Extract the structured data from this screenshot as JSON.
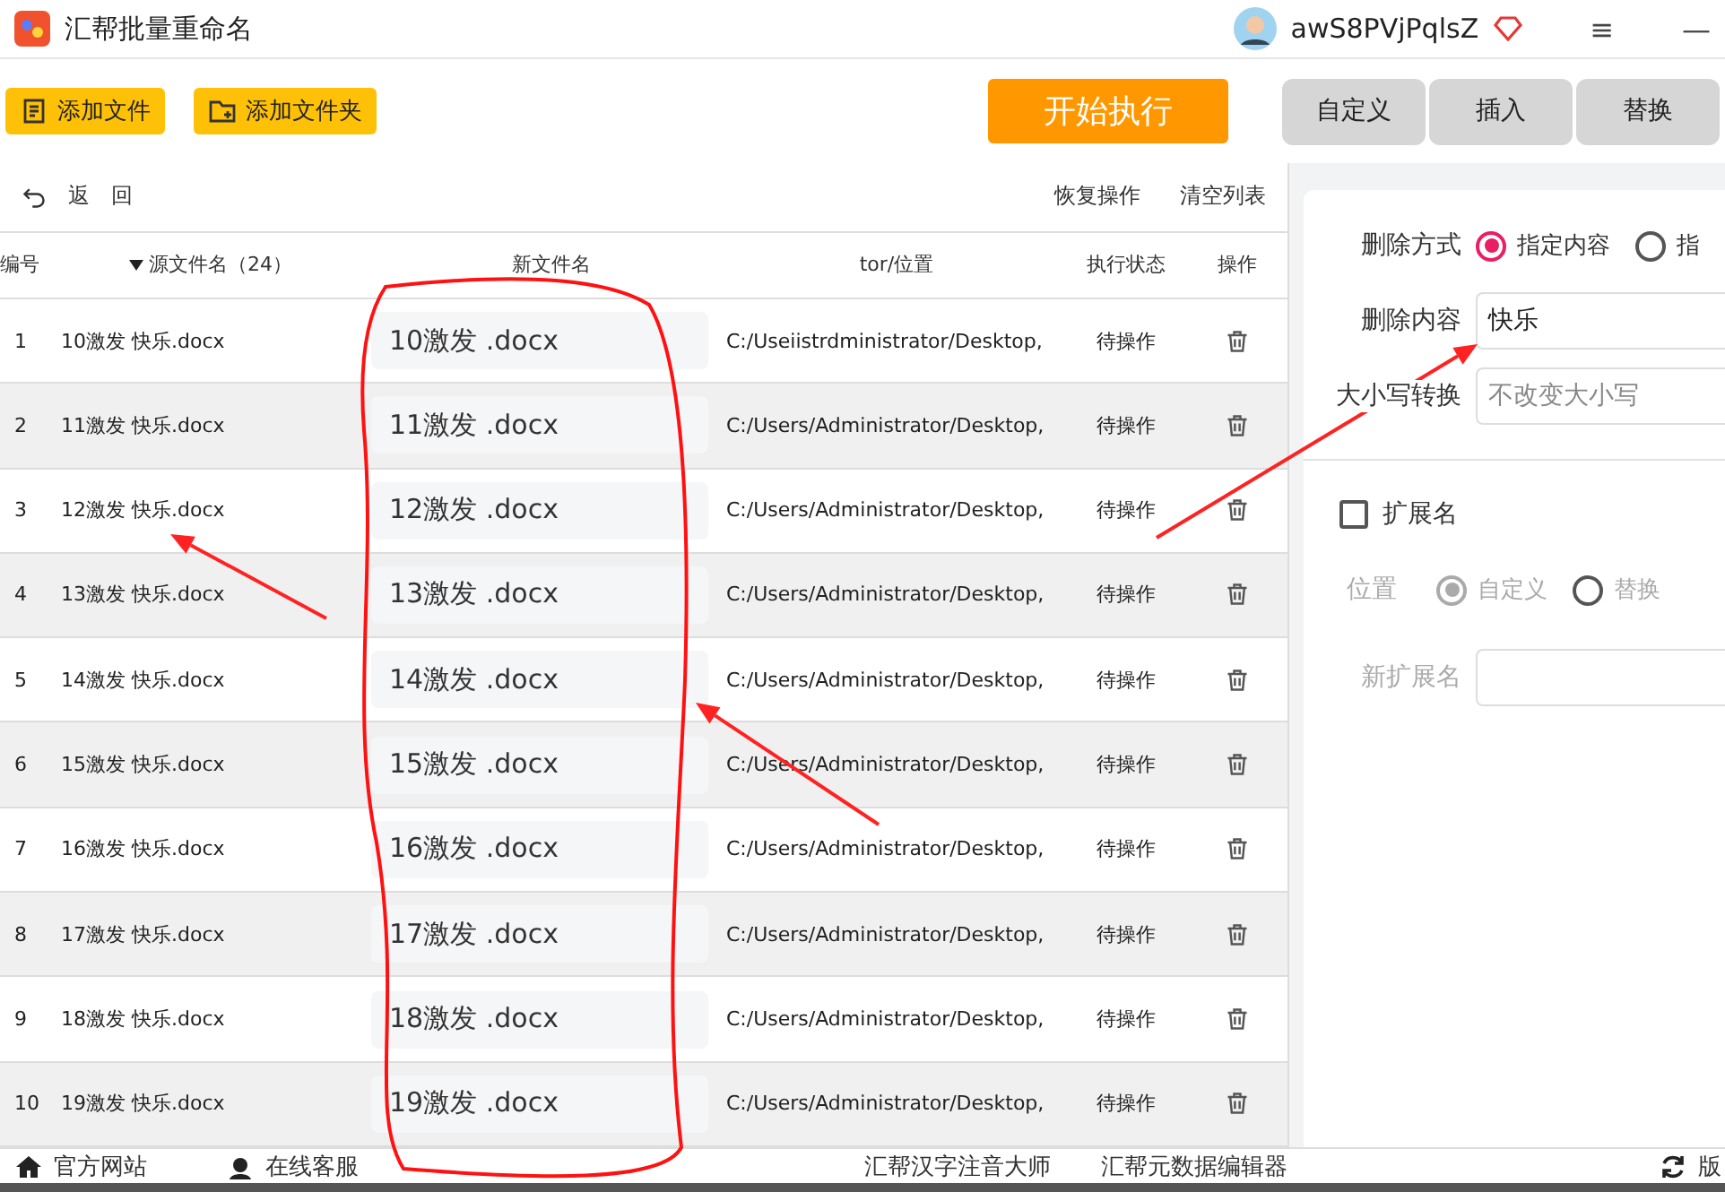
{
  "window": {
    "title": "汇帮批量重命名",
    "user": "awS8PVjPqlsZ",
    "menu_glyph": "≡",
    "minimize_glyph": "—"
  },
  "toolbar": {
    "add_buttons": [
      "添加文件",
      "添加文件夹"
    ],
    "start": "开始执行",
    "mode_tabs": [
      {
        "label": "自定义"
      },
      {
        "label": "插入"
      },
      {
        "label": "替换"
      }
    ]
  },
  "list_actions": {
    "back": [
      "返",
      "回"
    ],
    "right": [
      "恢复操作",
      "清空列表"
    ]
  },
  "table": {
    "columns": [
      "编号",
      "源文件名（24）",
      "新文件名",
      "tor/位置",
      "执行状态",
      "操作"
    ],
    "rows": [
      {
        "index": "1",
        "source": "10激发 快乐.docx",
        "new_name": "10激发 .docx",
        "path": "C:/Useiistrdministrator/Desktop,",
        "status": "待操作"
      },
      {
        "index": "2",
        "source": "11激发 快乐.docx",
        "new_name": "11激发 .docx",
        "path": "C:/Users/Administrator/Desktop,",
        "status": "待操作"
      },
      {
        "index": "3",
        "source": "12激发 快乐.docx",
        "new_name": "12激发 .docx",
        "path": "C:/Users/Administrator/Desktop,",
        "status": "待操作"
      },
      {
        "index": "4",
        "source": "13激发 快乐.docx",
        "new_name": "13激发 .docx",
        "path": "C:/Users/Administrator/Desktop,",
        "status": "待操作"
      },
      {
        "index": "5",
        "source": "14激发 快乐.docx",
        "new_name": "14激发 .docx",
        "path": "C:/Users/Administrator/Desktop,",
        "status": "待操作"
      },
      {
        "index": "6",
        "source": "15激发 快乐.docx",
        "new_name": "15激发 .docx",
        "path": "C:/Users/Administrator/Desktop,",
        "status": "待操作"
      },
      {
        "index": "7",
        "source": "16激发 快乐.docx",
        "new_name": "16激发 .docx",
        "path": "C:/Users/Administrator/Desktop,",
        "status": "待操作"
      },
      {
        "index": "8",
        "source": "17激发 快乐.docx",
        "new_name": "17激发 .docx",
        "path": "C:/Users/Administrator/Desktop,",
        "status": "待操作"
      },
      {
        "index": "9",
        "source": "18激发 快乐.docx",
        "new_name": "18激发 .docx",
        "path": "C:/Users/Administrator/Desktop,",
        "status": "待操作"
      },
      {
        "index": "10",
        "source": "19激发 快乐.docx",
        "new_name": "19激发 .docx",
        "path": "C:/Users/Administrator/Desktop,",
        "status": "待操作"
      }
    ]
  },
  "settings": {
    "delete_mode": {
      "label": "删除方式",
      "options": [
        {
          "label": "指定内容",
          "selected": true
        },
        {
          "label": "指",
          "selected": false
        }
      ]
    },
    "delete_content": {
      "label": "删除内容",
      "value": "快乐"
    },
    "case": {
      "label": "大小写转换",
      "placeholder": "不改变大小写"
    },
    "extension": {
      "label": "扩展名",
      "checked": false
    },
    "position": {
      "label": "位置",
      "disabled": true,
      "options": [
        {
          "label": "自定义",
          "selected": true
        },
        {
          "label": "替换",
          "selected": false
        }
      ]
    },
    "new_extension": {
      "label": "新扩展名",
      "disabled": true
    }
  },
  "footer": {
    "left": [
      "官方网站",
      "在线客服"
    ],
    "center": [
      "汇帮汉字注音大师",
      "汇帮元数据编辑器"
    ],
    "right": "版"
  }
}
